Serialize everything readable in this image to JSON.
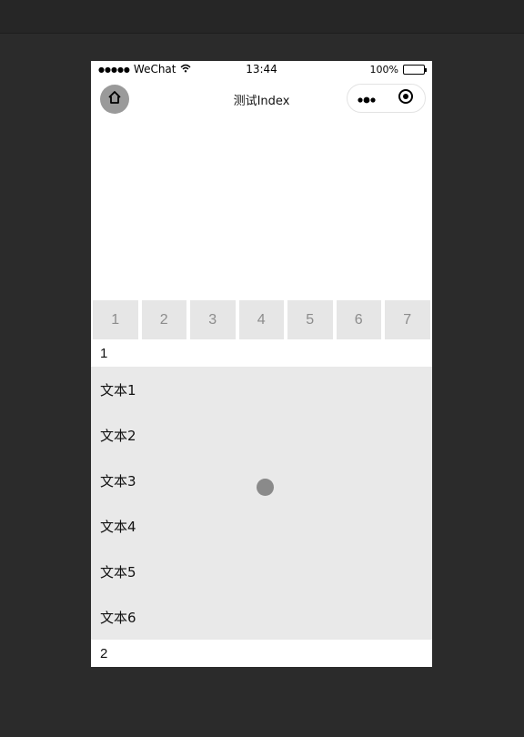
{
  "status_bar": {
    "signal": "●●●●●",
    "carrier": "WeChat",
    "time": "13:44",
    "battery": "100%"
  },
  "nav": {
    "title": "测试Index"
  },
  "tabs": [
    {
      "label": "1"
    },
    {
      "label": "2"
    },
    {
      "label": "3"
    },
    {
      "label": "4"
    },
    {
      "label": "5"
    },
    {
      "label": "6"
    },
    {
      "label": "7"
    }
  ],
  "sections": [
    {
      "title": "1"
    },
    {
      "title": "2"
    }
  ],
  "list_items": [
    {
      "label": "文本1"
    },
    {
      "label": "文本2"
    },
    {
      "label": "文本3"
    },
    {
      "label": "文本4"
    },
    {
      "label": "文本5"
    },
    {
      "label": "文本6"
    }
  ],
  "icons": {
    "home": "home-icon",
    "more": "more-dots-icon",
    "close": "target-icon",
    "wifi": "wifi-icon",
    "battery": "battery-icon"
  }
}
